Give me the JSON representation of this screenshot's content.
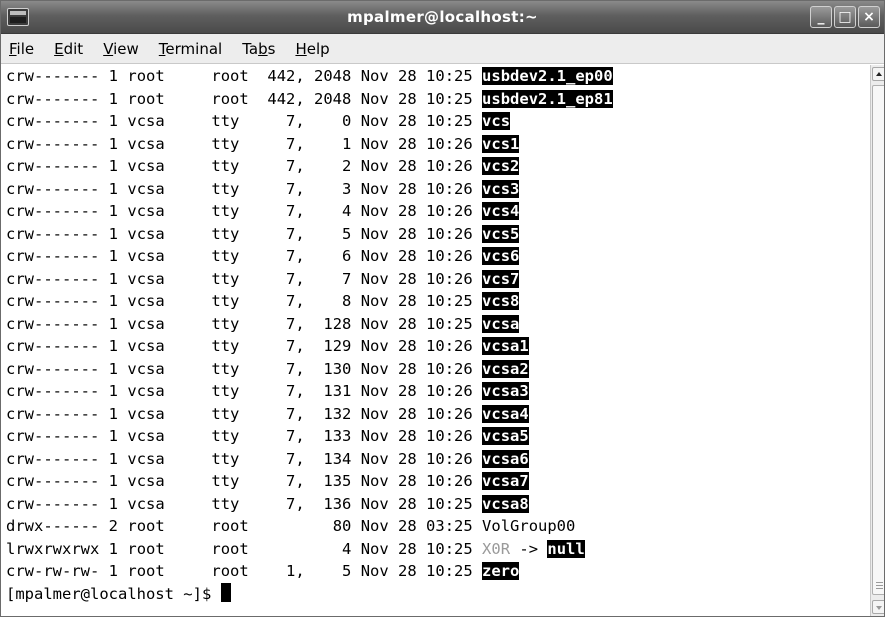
{
  "window": {
    "title": "mpalmer@localhost:~",
    "buttons": {
      "minimize": "_",
      "maximize": "□",
      "close": "×"
    }
  },
  "menu": [
    {
      "prefix": "",
      "mnemonic": "F",
      "suffix": "ile"
    },
    {
      "prefix": "",
      "mnemonic": "E",
      "suffix": "dit"
    },
    {
      "prefix": "",
      "mnemonic": "V",
      "suffix": "iew"
    },
    {
      "prefix": "",
      "mnemonic": "T",
      "suffix": "erminal"
    },
    {
      "prefix": "Ta",
      "mnemonic": "b",
      "suffix": "s"
    },
    {
      "prefix": "",
      "mnemonic": "H",
      "suffix": "elp"
    }
  ],
  "terminal": {
    "rows": [
      {
        "perm": "crw-------",
        "links": "1",
        "owner": "root",
        "group": "root",
        "size": "442, 2048",
        "date": "Nov 28 10:25",
        "name": "usbdev2.1_ep00",
        "style": "hl"
      },
      {
        "perm": "crw-------",
        "links": "1",
        "owner": "root",
        "group": "root",
        "size": "442, 2048",
        "date": "Nov 28 10:25",
        "name": "usbdev2.1_ep81",
        "style": "hl"
      },
      {
        "perm": "crw-------",
        "links": "1",
        "owner": "vcsa",
        "group": "tty",
        "size": "7,    0",
        "date": "Nov 28 10:25",
        "name": "vcs",
        "style": "hl"
      },
      {
        "perm": "crw-------",
        "links": "1",
        "owner": "vcsa",
        "group": "tty",
        "size": "7,    1",
        "date": "Nov 28 10:26",
        "name": "vcs1",
        "style": "hl"
      },
      {
        "perm": "crw-------",
        "links": "1",
        "owner": "vcsa",
        "group": "tty",
        "size": "7,    2",
        "date": "Nov 28 10:26",
        "name": "vcs2",
        "style": "hl"
      },
      {
        "perm": "crw-------",
        "links": "1",
        "owner": "vcsa",
        "group": "tty",
        "size": "7,    3",
        "date": "Nov 28 10:26",
        "name": "vcs3",
        "style": "hl"
      },
      {
        "perm": "crw-------",
        "links": "1",
        "owner": "vcsa",
        "group": "tty",
        "size": "7,    4",
        "date": "Nov 28 10:26",
        "name": "vcs4",
        "style": "hl"
      },
      {
        "perm": "crw-------",
        "links": "1",
        "owner": "vcsa",
        "group": "tty",
        "size": "7,    5",
        "date": "Nov 28 10:26",
        "name": "vcs5",
        "style": "hl"
      },
      {
        "perm": "crw-------",
        "links": "1",
        "owner": "vcsa",
        "group": "tty",
        "size": "7,    6",
        "date": "Nov 28 10:26",
        "name": "vcs6",
        "style": "hl"
      },
      {
        "perm": "crw-------",
        "links": "1",
        "owner": "vcsa",
        "group": "tty",
        "size": "7,    7",
        "date": "Nov 28 10:26",
        "name": "vcs7",
        "style": "hl"
      },
      {
        "perm": "crw-------",
        "links": "1",
        "owner": "vcsa",
        "group": "tty",
        "size": "7,    8",
        "date": "Nov 28 10:25",
        "name": "vcs8",
        "style": "hl"
      },
      {
        "perm": "crw-------",
        "links": "1",
        "owner": "vcsa",
        "group": "tty",
        "size": "7,  128",
        "date": "Nov 28 10:25",
        "name": "vcsa",
        "style": "hl"
      },
      {
        "perm": "crw-------",
        "links": "1",
        "owner": "vcsa",
        "group": "tty",
        "size": "7,  129",
        "date": "Nov 28 10:26",
        "name": "vcsa1",
        "style": "hl"
      },
      {
        "perm": "crw-------",
        "links": "1",
        "owner": "vcsa",
        "group": "tty",
        "size": "7,  130",
        "date": "Nov 28 10:26",
        "name": "vcsa2",
        "style": "hl"
      },
      {
        "perm": "crw-------",
        "links": "1",
        "owner": "vcsa",
        "group": "tty",
        "size": "7,  131",
        "date": "Nov 28 10:26",
        "name": "vcsa3",
        "style": "hl"
      },
      {
        "perm": "crw-------",
        "links": "1",
        "owner": "vcsa",
        "group": "tty",
        "size": "7,  132",
        "date": "Nov 28 10:26",
        "name": "vcsa4",
        "style": "hl"
      },
      {
        "perm": "crw-------",
        "links": "1",
        "owner": "vcsa",
        "group": "tty",
        "size": "7,  133",
        "date": "Nov 28 10:26",
        "name": "vcsa5",
        "style": "hl"
      },
      {
        "perm": "crw-------",
        "links": "1",
        "owner": "vcsa",
        "group": "tty",
        "size": "7,  134",
        "date": "Nov 28 10:26",
        "name": "vcsa6",
        "style": "hl"
      },
      {
        "perm": "crw-------",
        "links": "1",
        "owner": "vcsa",
        "group": "tty",
        "size": "7,  135",
        "date": "Nov 28 10:26",
        "name": "vcsa7",
        "style": "hl"
      },
      {
        "perm": "crw-------",
        "links": "1",
        "owner": "vcsa",
        "group": "tty",
        "size": "7,  136",
        "date": "Nov 28 10:25",
        "name": "vcsa8",
        "style": "hl"
      },
      {
        "perm": "drwx------",
        "links": "2",
        "owner": "root",
        "group": "root",
        "size": "80",
        "date": "Nov 28 03:25",
        "name": "VolGroup00",
        "style": "plain"
      },
      {
        "perm": "lrwxrwxrwx",
        "links": "1",
        "owner": "root",
        "group": "root",
        "size": "4",
        "date": "Nov 28 10:25",
        "name": "X0R",
        "style": "grey",
        "link_arrow": "->",
        "link_target": "null"
      },
      {
        "perm": "crw-rw-rw-",
        "links": "1",
        "owner": "root",
        "group": "root",
        "size": "1,    5",
        "date": "Nov 28 10:25",
        "name": "zero",
        "style": "hl"
      }
    ],
    "prompt": "[mpalmer@localhost ~]$ "
  }
}
